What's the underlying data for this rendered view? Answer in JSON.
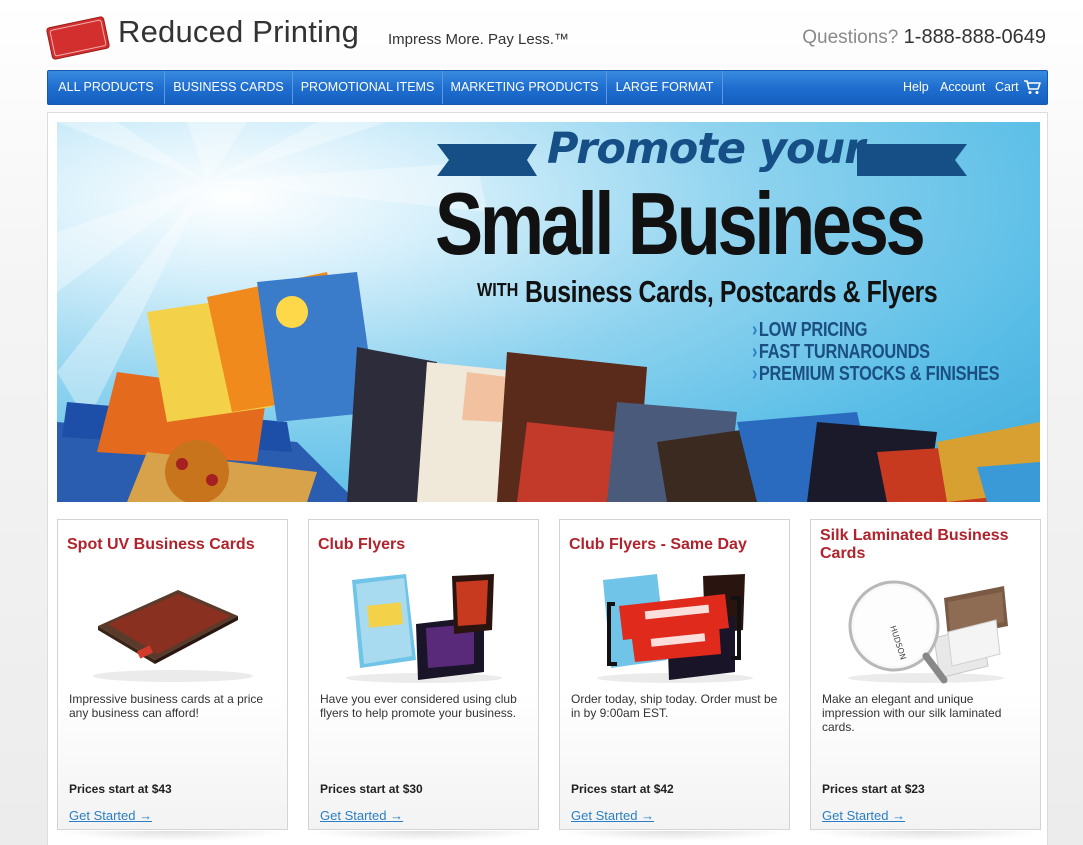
{
  "header": {
    "logo_text_top": "REDUCED",
    "logo_text_bottom": "PRINTING",
    "site_title": "Reduced Printing",
    "tagline": "Impress More. Pay Less.™",
    "questions_label": "Questions?",
    "phone": "1-888-888-0649"
  },
  "nav": {
    "items": [
      {
        "label": "ALL PRODUCTS"
      },
      {
        "label": "BUSINESS CARDS"
      },
      {
        "label": "PROMOTIONAL ITEMS"
      },
      {
        "label": "MARKETING PRODUCTS"
      },
      {
        "label": "LARGE FORMAT"
      }
    ],
    "help": "Help",
    "account": "Account",
    "cart": "Cart",
    "cart_icon": "cart-icon"
  },
  "hero": {
    "line1": "Promote your",
    "line2": "Small Business",
    "with": "WITH",
    "line3": "Business Cards, Postcards & Flyers",
    "bullets": [
      "LOW PRICING",
      "FAST TURNAROUNDS",
      "PREMIUM STOCKS & FINISHES"
    ],
    "colors": {
      "accent": "#164f86",
      "sky": "#58bde6"
    }
  },
  "products": [
    {
      "title": "Spot UV Business Cards",
      "description": "Impressive business cards at a price any business can afford!",
      "price": "Prices start at $43",
      "cta": "Get Started →"
    },
    {
      "title": "Club Flyers",
      "description": "Have you ever considered using club flyers to help promote your business.",
      "price": "Prices start at $30",
      "cta": "Get Started →"
    },
    {
      "title": "Club Flyers - Same Day",
      "description": "Order today, ship today. Order must be in by 9:00am EST.",
      "price": "Prices start at $42",
      "cta": "Get Started →"
    },
    {
      "title": "Silk Laminated Business Cards",
      "description": "Make an elegant and unique impression with our silk laminated cards.",
      "price": "Prices start at $23",
      "cta": "Get Started →"
    }
  ],
  "colors": {
    "nav_blue": "#1f6ecf",
    "title_red": "#b0232c",
    "link_blue": "#2a7fc4"
  }
}
